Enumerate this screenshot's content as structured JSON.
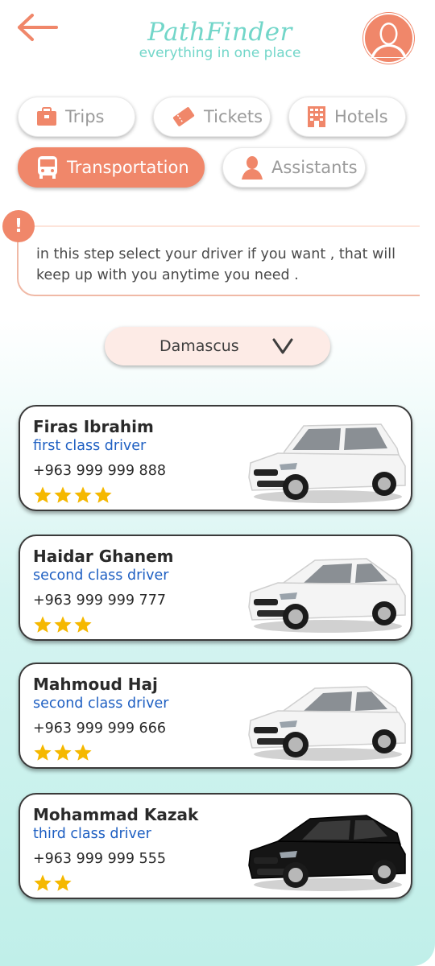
{
  "header": {
    "title": "PathFinder",
    "subtitle": "everything in one place"
  },
  "categories": [
    {
      "label": "Trips",
      "icon": "briefcase-icon",
      "active": false
    },
    {
      "label": "Tickets",
      "icon": "ticket-icon",
      "active": false
    },
    {
      "label": "Hotels",
      "icon": "building-icon",
      "active": false
    },
    {
      "label": "Transportation",
      "icon": "bus-icon",
      "active": true
    },
    {
      "label": "Assistants",
      "icon": "person-icon",
      "active": false
    }
  ],
  "notice": {
    "badge": "!",
    "text": "in this step select your driver if you want , that will keep up with you anytime you need ."
  },
  "city_select": {
    "value": "Damascus"
  },
  "drivers": [
    {
      "name": "Firas Ibrahim",
      "class": "first class driver",
      "phone": "+963 999 999 888",
      "rating": 4,
      "car_color": "white",
      "car_style": "suv"
    },
    {
      "name": "Haidar Ghanem",
      "class": "second class driver",
      "phone": "+963 999 999 777",
      "rating": 3,
      "car_color": "white",
      "car_style": "coupe"
    },
    {
      "name": "Mahmoud Haj",
      "class": "second class driver",
      "phone": "+963 999 999 666",
      "rating": 3,
      "car_color": "white",
      "car_style": "coupe"
    },
    {
      "name": "Mohammad Kazak",
      "class": "third class driver",
      "phone": "+963 999 999 555",
      "rating": 2,
      "car_color": "black",
      "car_style": "hatch"
    }
  ],
  "colors": {
    "accent": "#f0876a",
    "brand": "#72d6c9",
    "link": "#1e5fc2",
    "star": "#f5b800"
  }
}
